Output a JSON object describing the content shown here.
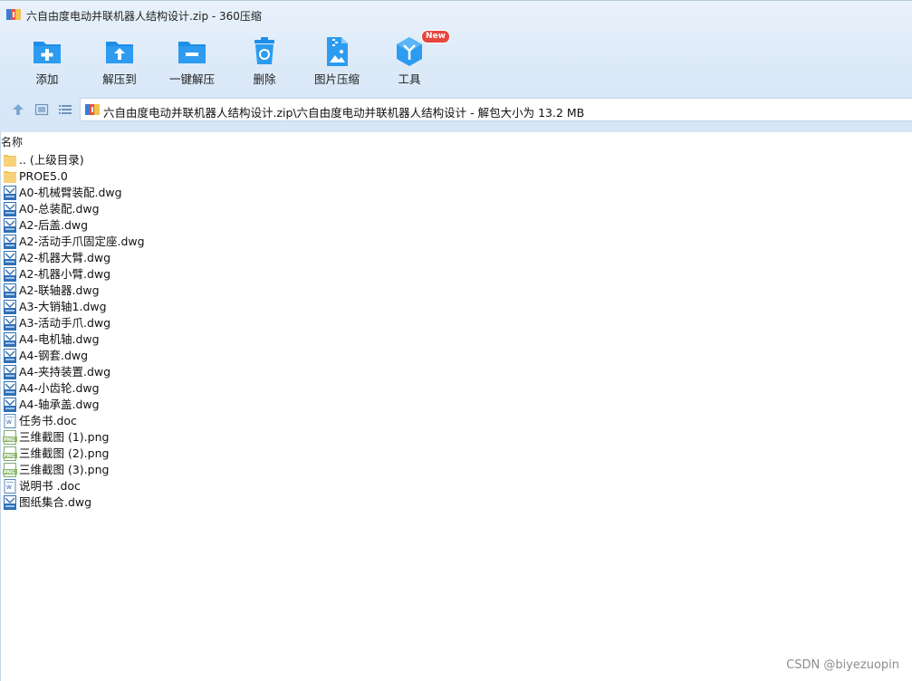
{
  "window": {
    "title": "六自由度电动并联机器人结构设计.zip - 360压缩"
  },
  "toolbar": {
    "items": [
      {
        "label": "添加",
        "icon": "add-folder-icon"
      },
      {
        "label": "解压到",
        "icon": "extract-to-icon"
      },
      {
        "label": "一键解压",
        "icon": "one-click-extract-icon"
      },
      {
        "label": "删除",
        "icon": "delete-icon"
      },
      {
        "label": "图片压缩",
        "icon": "image-compress-icon"
      },
      {
        "label": "工具",
        "icon": "tools-icon",
        "badge": "New"
      }
    ]
  },
  "address": {
    "path": "六自由度电动并联机器人结构设计.zip\\六自由度电动并联机器人结构设计 - 解包大小为 13.2 MB"
  },
  "list": {
    "header_name": "名称",
    "items": [
      {
        "name": ".. (上级目录)",
        "type": "folder"
      },
      {
        "name": "PROE5.0",
        "type": "folder"
      },
      {
        "name": "A0-机械臂装配.dwg",
        "type": "dwg"
      },
      {
        "name": "A0-总装配.dwg",
        "type": "dwg"
      },
      {
        "name": "A2-后盖.dwg",
        "type": "dwg"
      },
      {
        "name": "A2-活动手爪固定座.dwg",
        "type": "dwg"
      },
      {
        "name": "A2-机器大臂.dwg",
        "type": "dwg"
      },
      {
        "name": "A2-机器小臂.dwg",
        "type": "dwg"
      },
      {
        "name": "A2-联轴器.dwg",
        "type": "dwg"
      },
      {
        "name": "A3-大销轴1.dwg",
        "type": "dwg"
      },
      {
        "name": "A3-活动手爪.dwg",
        "type": "dwg"
      },
      {
        "name": "A4-电机轴.dwg",
        "type": "dwg"
      },
      {
        "name": "A4-钢套.dwg",
        "type": "dwg"
      },
      {
        "name": "A4-夹持装置.dwg",
        "type": "dwg"
      },
      {
        "name": "A4-小齿轮.dwg",
        "type": "dwg"
      },
      {
        "name": "A4-轴承盖.dwg",
        "type": "dwg"
      },
      {
        "name": "任务书.doc",
        "type": "doc"
      },
      {
        "name": "三维截图 (1).png",
        "type": "png"
      },
      {
        "name": "三维截图 (2).png",
        "type": "png"
      },
      {
        "name": "三维截图 (3).png",
        "type": "png"
      },
      {
        "name": "说明书 .doc",
        "type": "doc"
      },
      {
        "name": "图纸集合.dwg",
        "type": "dwg"
      }
    ]
  },
  "watermark": "CSDN @biyezuopin",
  "colors": {
    "toolbar_icon_blue": "#1f8ee8",
    "folder_yellow": "#f7d27a",
    "badge_red": "#e8463d",
    "chrome_bg": "#dbe9f8"
  }
}
